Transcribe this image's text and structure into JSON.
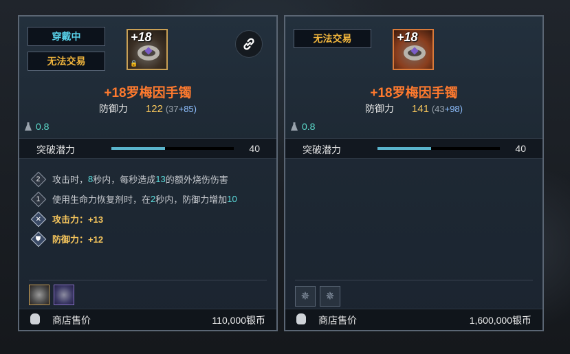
{
  "left": {
    "tags": [
      "穿戴中",
      "无法交易"
    ],
    "item_level": "+18",
    "title": "+18罗梅因手镯",
    "stat_label": "防御力",
    "stat_value": "122",
    "stat_base": "(37",
    "stat_bonus": "+85)",
    "weight": "0.8",
    "potential_label": "突破潜力",
    "potential_value": "40",
    "potential_fill": 0.44,
    "effects": [
      {
        "badge": "2",
        "parts": [
          "攻击时，",
          "8",
          "秒内，每秒造成",
          "13",
          "的额外烧伤伤害"
        ]
      },
      {
        "badge": "1",
        "parts": [
          "使用生命力恢复剂时，在",
          "2",
          "秒内，防御力增加",
          "10"
        ]
      },
      {
        "badge": "✕",
        "text": "攻击力：+13"
      },
      {
        "badge": "⛊",
        "text": "防御力：+12"
      }
    ],
    "sell_label": "商店售价",
    "sell_value": "110,000银币"
  },
  "right": {
    "tag": "无法交易",
    "item_level": "+18",
    "title": "+18罗梅因手镯",
    "stat_label": "防御力",
    "stat_value": "141",
    "stat_base": "(43",
    "stat_bonus": "+98)",
    "weight": "0.8",
    "potential_label": "突破潜力",
    "potential_value": "40",
    "potential_fill": 0.44,
    "slot_icon": "✵",
    "sell_label": "商店售价",
    "sell_value": "1,600,000银币"
  },
  "icons": {
    "link": "link-icon",
    "weight": "weight-icon",
    "bag": "money-bag-icon",
    "lock": "lock-icon"
  },
  "colors": {
    "title": "#ff7a2e",
    "tag_gold": "#f1b53c",
    "tag_cyan": "#58d0e8",
    "highlight": "#5ee0e0",
    "potential_bar": "#5ab4cc"
  }
}
